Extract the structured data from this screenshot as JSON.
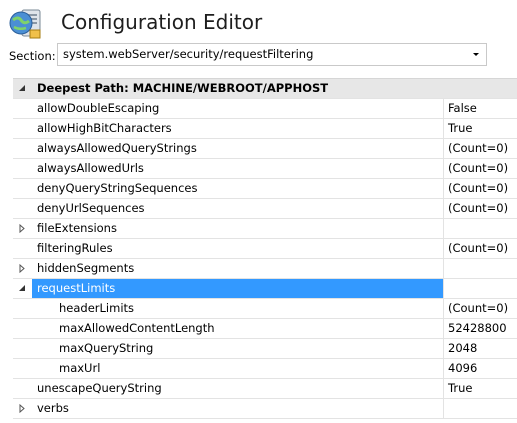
{
  "header": {
    "title": "Configuration Editor",
    "icon": "config-editor-icon"
  },
  "section": {
    "label": "Section:",
    "value": "system.webServer/security/requestFiltering"
  },
  "grid": {
    "category_label": "Deepest Path: MACHINE/WEBROOT/APPHOST",
    "rows": [
      {
        "name": "allowDoubleEscaping",
        "value": "False"
      },
      {
        "name": "allowHighBitCharacters",
        "value": "True"
      },
      {
        "name": "alwaysAllowedQueryStrings",
        "value": "(Count=0)"
      },
      {
        "name": "alwaysAllowedUrls",
        "value": "(Count=0)"
      },
      {
        "name": "denyQueryStringSequences",
        "value": "(Count=0)"
      },
      {
        "name": "denyUrlSequences",
        "value": "(Count=0)"
      },
      {
        "name": "fileExtensions",
        "value": ""
      },
      {
        "name": "filteringRules",
        "value": "(Count=0)"
      },
      {
        "name": "hiddenSegments",
        "value": ""
      },
      {
        "name": "requestLimits",
        "value": ""
      },
      {
        "name": "headerLimits",
        "value": "(Count=0)"
      },
      {
        "name": "maxAllowedContentLength",
        "value": "52428800"
      },
      {
        "name": "maxQueryString",
        "value": "2048"
      },
      {
        "name": "maxUrl",
        "value": "4096"
      },
      {
        "name": "unescapeQueryString",
        "value": "True"
      },
      {
        "name": "verbs",
        "value": ""
      }
    ]
  },
  "colors": {
    "selection": "#3399ff",
    "category_bg": "#e7e7e7"
  }
}
